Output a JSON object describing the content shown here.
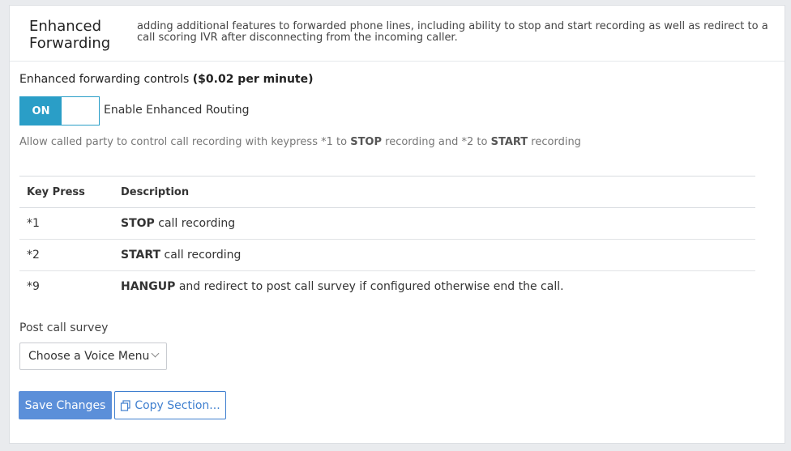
{
  "header": {
    "title": "Enhanced Forwarding",
    "description": "adding additional features to forwarded phone lines, including ability to stop and start recording as well as redirect to a call scoring IVR after disconnecting from the incoming caller."
  },
  "controls": {
    "label_prefix": "Enhanced forwarding controls ",
    "label_price": "($0.02 per minute)",
    "toggle_state": "ON",
    "toggle_label": "Enable Enhanced Routing",
    "help_part1": "Allow called party to control call recording with keypress *1 to ",
    "help_stop": "STOP",
    "help_part2": " recording and *2 to ",
    "help_start": "START",
    "help_part3": " recording",
    "accent_color": "#2a9ec7"
  },
  "table": {
    "headers": [
      "Key Press",
      "Description"
    ],
    "rows": [
      {
        "key": "*1",
        "bold": "STOP",
        "rest": " call recording"
      },
      {
        "key": "*2",
        "bold": "START",
        "rest": " call recording"
      },
      {
        "key": "*9",
        "bold": "HANGUP",
        "rest": " and redirect to post call survey if configured otherwise end the call."
      }
    ]
  },
  "survey": {
    "label": "Post call survey",
    "selected": "Choose a Voice Menu"
  },
  "actions": {
    "save_label": "Save Changes",
    "copy_label": "Copy Section...",
    "copy_icon": "copy-icon"
  }
}
